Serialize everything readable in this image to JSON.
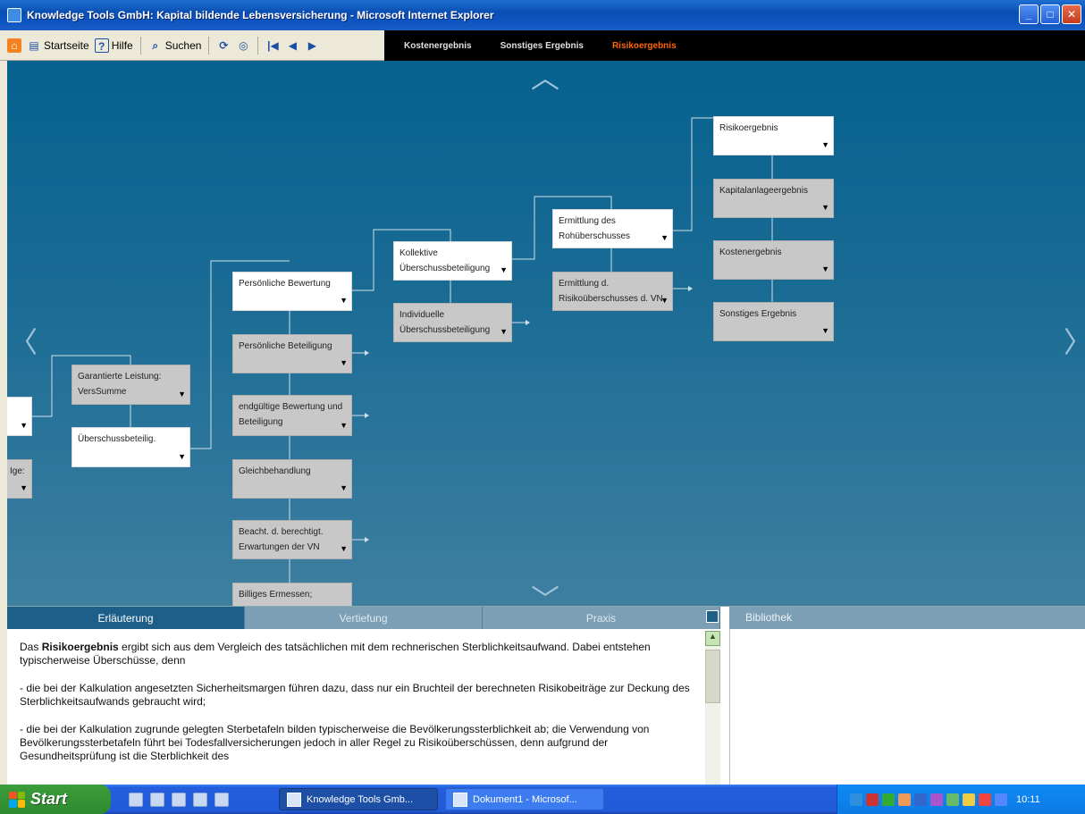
{
  "window": {
    "title": "Knowledge Tools GmbH: Kapital bildende Lebensversicherung - Microsoft Internet Explorer",
    "minimize_label": "_",
    "maximize_label": "□",
    "close_label": "✕"
  },
  "toolbar": {
    "items": [
      {
        "label": "Startseite"
      },
      {
        "label": "Hilfe"
      },
      {
        "label": "Suchen"
      }
    ],
    "arrow_left_label": "◀",
    "arrow_right_label": "▶",
    "nav_first_label": "|◀"
  },
  "tabs": {
    "items": [
      {
        "label": "Kostenergebnis"
      },
      {
        "label": "Sonstiges Ergebnis"
      },
      {
        "label": "Risikoergebnis"
      }
    ],
    "active_index": 2
  },
  "diagram": {
    "up_arrow": "︿",
    "down_arrow": "﹀",
    "left_arrow": "〈",
    "right_arrow": "〉",
    "nodes": [
      {
        "id": "n-edge-1",
        "label": ""
      },
      {
        "id": "n-edge-2",
        "label": "Ige:"
      },
      {
        "id": "n-garantierte",
        "label": "Garantierte Leistung: VersSumme"
      },
      {
        "id": "n-ueberschuss",
        "label": "Überschussbeteilig."
      },
      {
        "id": "n-pers-bewertung",
        "label": "Persönliche Bewertung"
      },
      {
        "id": "n-pers-beteiligung",
        "label": "Persönliche Beteiligung"
      },
      {
        "id": "n-endgueltige",
        "label": "endgültige Bewertung und Beteiligung"
      },
      {
        "id": "n-gleichbehandlung",
        "label": "Gleichbehandlung"
      },
      {
        "id": "n-beacht",
        "label": "Beacht. d. berechtigt. Erwartungen der VN"
      },
      {
        "id": "n-billiges",
        "label": "Billiges Ermessen;"
      },
      {
        "id": "n-kollektive",
        "label": "Kollektive Überschussbeteiligung"
      },
      {
        "id": "n-individuelle",
        "label": "Individuelle Überschussbeteiligung"
      },
      {
        "id": "n-ermittlung-roh",
        "label": "Ermittlung des Rohüberschusses"
      },
      {
        "id": "n-ermittlung-risiko",
        "label": "Ermittlung d. Risikoüberschusses d. VN"
      },
      {
        "id": "n-risikoergebnis",
        "label": "Risikoergebnis"
      },
      {
        "id": "n-kapitalanlage",
        "label": "Kapitalanlageergebnis"
      },
      {
        "id": "n-kostenergebnis",
        "label": "Kostenergebnis"
      },
      {
        "id": "n-sonstiges",
        "label": "Sonstiges Ergebnis"
      }
    ]
  },
  "panel": {
    "tabs": [
      {
        "label": "Erläuterung"
      },
      {
        "label": "Vertiefung"
      },
      {
        "label": "Praxis"
      }
    ],
    "active_tab_index": 0,
    "bibliothek_label": "Bibliothek",
    "scroll_up": "▲",
    "scroll_down": "▼",
    "paragraph1_prefix": "Das ",
    "paragraph1_bold": "Risikoergebnis",
    "paragraph1_rest": " ergibt sich aus dem Vergleich des tatsächlichen mit dem rechnerischen Sterblichkeitsaufwand. Dabei entstehen typischerweise Überschüsse, denn",
    "paragraph2": "-        die bei der Kalkulation angesetzten Sicherheitsmargen führen dazu, dass nur ein Bruchteil der berechneten Risikobeiträge zur Deckung des Sterblichkeitsaufwands gebraucht wird;",
    "paragraph3": "-        die bei der Kalkulation zugrunde gelegten Sterbetafeln bilden typischerweise die Bevölkerungssterblichkeit ab; die Verwendung von Bevölkerungssterbetafeln führt bei Todesfallversicherungen jedoch in aller Regel zu Risikoüberschüssen, denn aufgrund der Gesundheitsprüfung ist die Sterblichkeit des"
  },
  "taskbar": {
    "start_label": "Start",
    "tasks": [
      {
        "label": "Knowledge Tools Gmb..."
      },
      {
        "label": "Dokument1 - Microsof..."
      }
    ],
    "clock": "10:11"
  }
}
